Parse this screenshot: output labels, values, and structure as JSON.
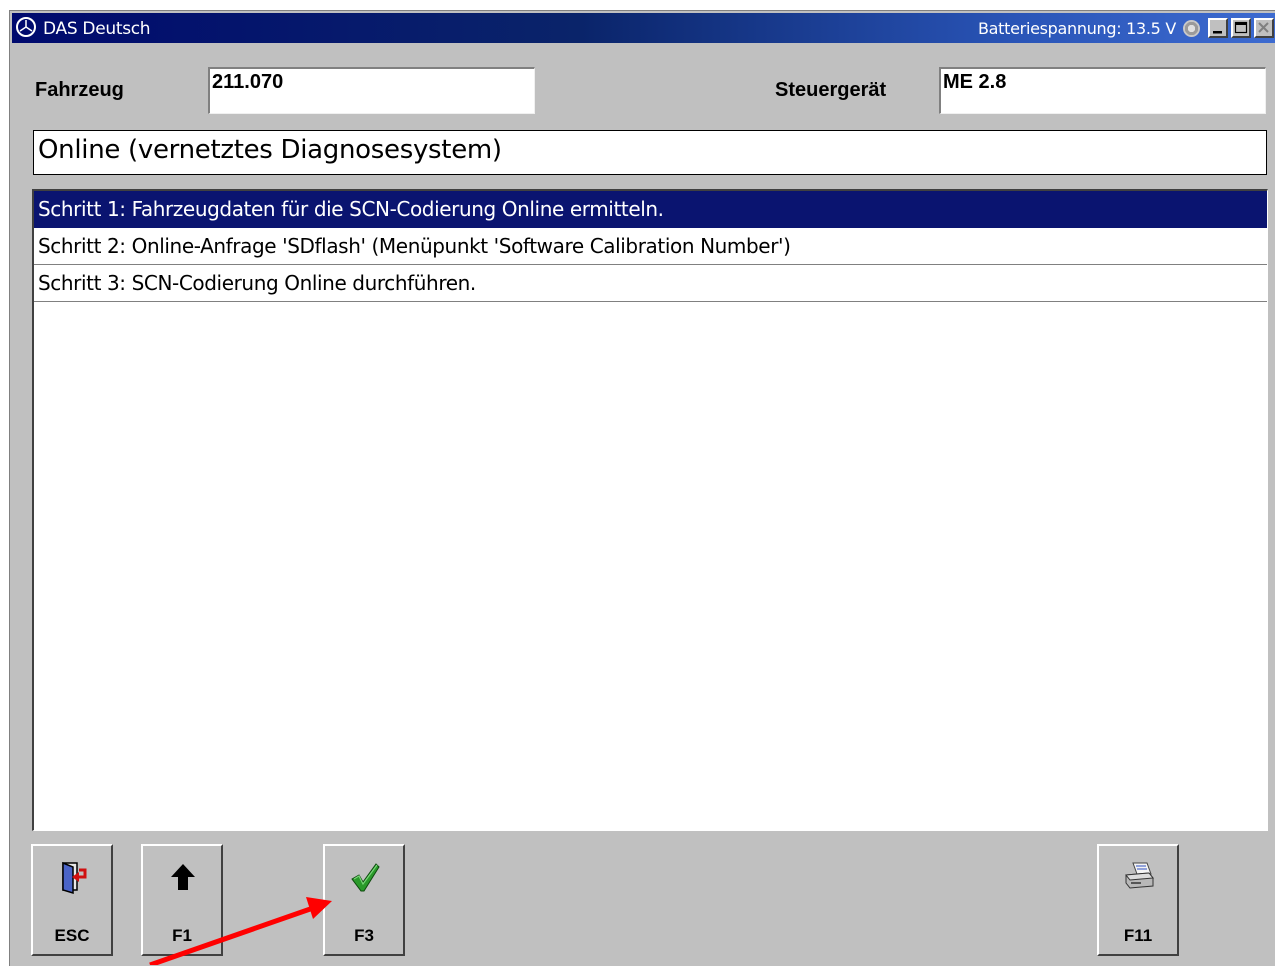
{
  "window": {
    "title": "DAS Deutsch",
    "battery_status": "Batteriespannung: 13.5 V",
    "logo_icon": "mercedes-star-icon",
    "controls": [
      "minimize",
      "maximize",
      "close"
    ]
  },
  "header": {
    "vehicle_label": "Fahrzeug",
    "vehicle_value": "211.070",
    "ecu_label": "Steuergerät",
    "ecu_value": "ME 2.8"
  },
  "panel_title": "Online (vernetztes Diagnosesystem)",
  "steps": [
    {
      "label": "Schritt 1: Fahrzeugdaten für die SCN-Codierung Online ermitteln.",
      "selected": true
    },
    {
      "label": "Schritt 2: Online-Anfrage 'SDflash' (Menüpunkt 'Software Calibration Number')",
      "selected": false
    },
    {
      "label": "Schritt 3: SCN-Codierung Online durchführen.",
      "selected": false
    }
  ],
  "function_keys": [
    {
      "label": "ESC",
      "icon": "exit-door-icon"
    },
    {
      "label": "F1",
      "icon": "arrow-up-icon"
    },
    {
      "label": "F3",
      "icon": "checkmark-icon"
    },
    {
      "label": "F11",
      "icon": "printer-icon"
    }
  ],
  "annotation": {
    "icon": "red-arrow-pointer",
    "color": "#ff0000"
  },
  "colors": {
    "selection": "#0a1470",
    "titlebar_start": "#000a6e",
    "titlebar_end": "#3d6bd0",
    "background": "#c0c0c0"
  }
}
